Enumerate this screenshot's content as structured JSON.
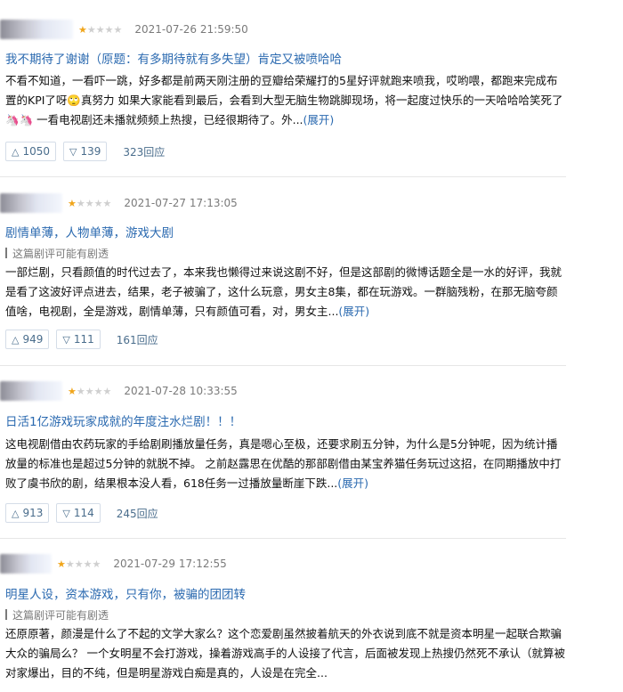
{
  "reviews": [
    {
      "rating_text": "★☆☆☆☆",
      "date": "2021-07-26 21:59:50",
      "title": "我不期待了谢谢（原题：有多期待就有多失望）肯定又被喷哈哈",
      "spoiler": "",
      "body": "不看不知道，一看吓一跳，好多都是前两天刚注册的豆瓣给荣耀打的5星好评就跑来喷我，哎哟喂，都跑来完成布置的KPI了呀🙄真努力 如果大家能看到最后，会看到大型无脑生物跳脚现场，将一起度过快乐的一天哈哈哈笑死了🦄🦄 一看电视剧还未播就频频上热搜，已经很期待了。外...",
      "more": "(展开)",
      "up": "1050",
      "down": "139",
      "replies": "323回应"
    },
    {
      "rating_text": "★☆☆☆☆",
      "date": "2021-07-27 17:13:05",
      "title": "剧情单薄，人物单薄，游戏大剧",
      "spoiler": "这篇剧评可能有剧透",
      "body": "一部烂剧，只看颜值的时代过去了，本来我也懒得过来说这剧不好，但是这部剧的微博话题全是一水的好评，我就是看了这波好评点进去，结果，老子被骗了，这什么玩意，男女主8集，都在玩游戏。一群脑残粉，在那无脑夸颜值啥，电视剧，全是游戏，剧情单薄，只有颜值可看，对，男女主...",
      "more": "(展开)",
      "up": "949",
      "down": "111",
      "replies": "161回应"
    },
    {
      "rating_text": "★☆☆☆☆",
      "date": "2021-07-28 10:33:55",
      "title": "日活1亿游戏玩家成就的年度注水烂剧！！！",
      "spoiler": "",
      "body": "这电视剧借由农药玩家的手给剧刷播放量任务，真是嗯心至极，还要求刷五分钟，为什么是5分钟呢，因为统计播放量的标准也是超过5分钟的就脱不掉。 之前赵露思在优酷的那部剧借由某宝养猫任务玩过这招，在同期播放中打败了虞书欣的剧，结果根本没人看，618任务一过播放量断崖下跌...",
      "more": "(展开)",
      "up": "913",
      "down": "114",
      "replies": "245回应"
    },
    {
      "rating_text": "★☆☆☆☆",
      "date": "2021-07-29 17:12:55",
      "title": "明星人设，资本游戏，只有你，被骗的团团转",
      "spoiler": "这篇剧评可能有剧透",
      "body": "还原原著，颜漫是什么了不起的文学大家么？这个恋爱剧虽然披着航天的外衣说到底不就是资本明星一起联合欺骗大众的骗局么？ 一个女明星不会打游戏，操着游戏高手的人设接了代言，后面被发现上热搜仍然死不承认（就算被对家爆出，目的不纯，但是明星游戏白痴是真的，人设是在完全...",
      "more": "",
      "up": "",
      "down": "",
      "replies": ""
    }
  ],
  "colors": {
    "link": "#2b6ab0",
    "star": "#f0a51b",
    "meta": "#7a7a7a"
  },
  "icons": {
    "up": "triangle-up-icon",
    "down": "triangle-down-icon",
    "star": "star-icon"
  }
}
